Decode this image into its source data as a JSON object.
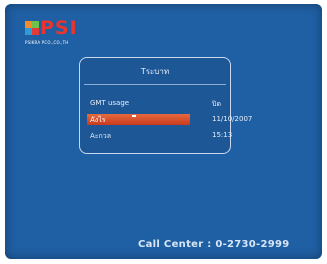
{
  "logo": {
    "brand": "PSI",
    "sub": "PSIKRA PCO.,CO.,TH"
  },
  "panel": {
    "title": "Tระบาท",
    "rows": [
      {
        "label": "GMT usage",
        "value": "ปิด"
      },
      {
        "label": "Aังไร",
        "value": "11/10/2007"
      },
      {
        "label": "Aะกวล",
        "value": "15:13"
      }
    ],
    "selected_index": 1
  },
  "footer": {
    "call_center": "Call Center : 0-2730-2999"
  },
  "colors": {
    "screen_bg": "#1f5fa3",
    "selection": "#d8512c",
    "brand": "#e8352f"
  }
}
